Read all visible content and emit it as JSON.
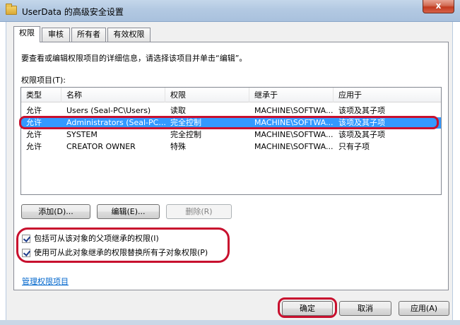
{
  "window": {
    "title": "UserData 的高级安全设置",
    "close_label": "x"
  },
  "tabs": [
    {
      "label": "权限",
      "active": true
    },
    {
      "label": "审核",
      "active": false
    },
    {
      "label": "所有者",
      "active": false
    },
    {
      "label": "有效权限",
      "active": false
    }
  ],
  "permissions": {
    "description": "要查看或编辑权限项目的详细信息，请选择该项目并单击“编辑”。",
    "list_label": "权限项目(T):",
    "columns": [
      "类型",
      "名称",
      "权限",
      "继承于",
      "应用于"
    ],
    "rows": [
      {
        "type": "允许",
        "name": "Users (Seal-PC\\Users)",
        "permission": "读取",
        "inherited": "MACHINE\\SOFTWA...",
        "applies": "该项及其子项",
        "selected": false
      },
      {
        "type": "允许",
        "name": "Administrators (Seal-PC...",
        "permission": "完全控制",
        "inherited": "MACHINE\\SOFTWA...",
        "applies": "该项及其子项",
        "selected": true
      },
      {
        "type": "允许",
        "name": "SYSTEM",
        "permission": "完全控制",
        "inherited": "MACHINE\\SOFTWA...",
        "applies": "该项及其子项",
        "selected": false
      },
      {
        "type": "允许",
        "name": "CREATOR OWNER",
        "permission": "特殊",
        "inherited": "MACHINE\\SOFTWA...",
        "applies": "只有子项",
        "selected": false
      }
    ],
    "add_label": "添加(D)...",
    "edit_label": "编辑(E)...",
    "remove_label": "删除(R)",
    "inherit_check_label": "包括可从该对象的父项继承的权限(I)",
    "replace_check_label": "使用可从此对象继承的权限替换所有子对象权限(P)",
    "manage_link": "管理权限项目"
  },
  "footer": {
    "ok_label": "确定",
    "cancel_label": "取消",
    "apply_label": "应用(A)"
  },
  "colors": {
    "selection": "#3399ff",
    "annotation": "#c8102e",
    "link": "#0066cc"
  }
}
